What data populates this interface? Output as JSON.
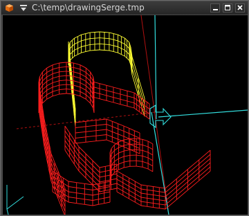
{
  "window": {
    "title": "C:\\temp\\drawingSerge.tmp",
    "controls": [
      "minimize-icon",
      "maximize-icon",
      "close-icon"
    ]
  },
  "viewport": {
    "background": "#000000",
    "colors": {
      "wire_red": "#ff1e1e",
      "wire_yellow": "#ffff33",
      "axis_cyan": "#33e0e0",
      "axis_darkred": "#b01010"
    }
  }
}
